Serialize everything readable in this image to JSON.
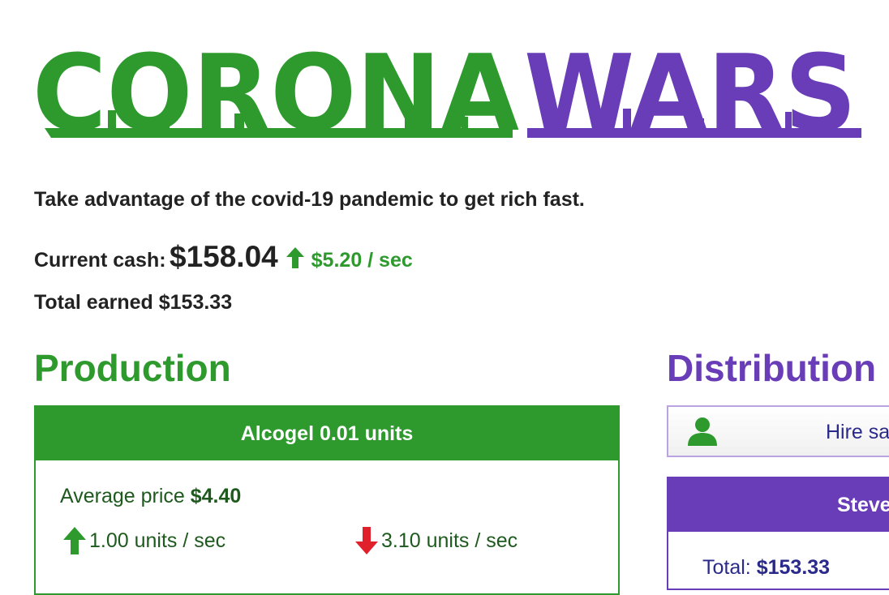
{
  "logo": {
    "word1": "CORONA",
    "word2": "WARS",
    "color1": "#2e9a2e",
    "color2": "#6a3db8"
  },
  "tagline": "Take advantage of the covid-19 pandemic to get rich fast.",
  "cash": {
    "label": "Current cash:",
    "value": "$158.04",
    "rate": "$5.20 / sec",
    "rate_icon": "arrow-up-icon"
  },
  "total": {
    "label": "Total earned",
    "value": "$153.33"
  },
  "production": {
    "heading": "Production",
    "panel_title": "Alcogel 0.01 units",
    "avg_label": "Average price",
    "avg_value": "$4.40",
    "rate_up": "1.00 units / sec",
    "rate_down": "3.10 units / sec"
  },
  "distribution": {
    "heading": "Distribution",
    "hire_label": "Hire sa",
    "hire_icon": "person-icon",
    "panel_title": "Steve",
    "total_label": "Total:",
    "total_value": "$153.33"
  }
}
